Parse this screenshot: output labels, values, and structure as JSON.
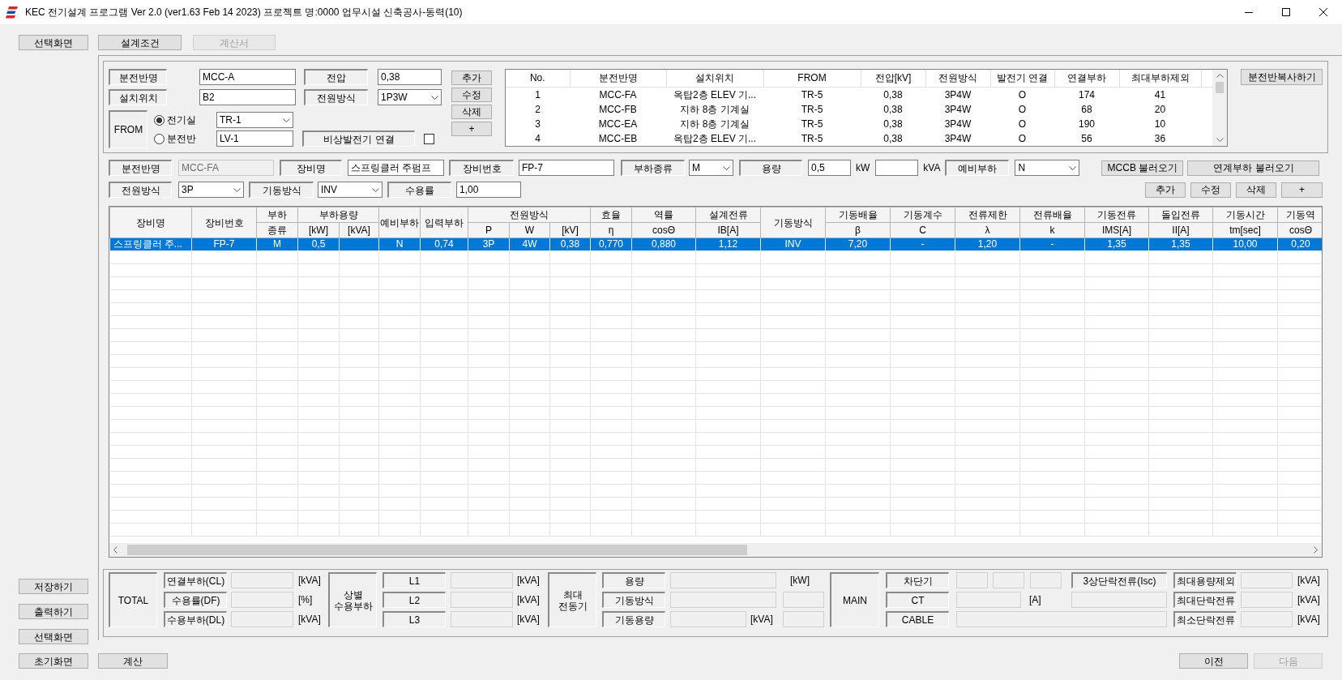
{
  "window": {
    "title": "KEC 전기설계 프로그램 Ver 2.0 (ver1.63 Feb 14 2023) 프로젝트 명:0000 업무시설 신축공사-동력(10)"
  },
  "top_buttons": [
    {
      "label": "선택화면",
      "disabled": false
    },
    {
      "label": "설계조건",
      "disabled": false
    },
    {
      "label": "계산서",
      "disabled": true
    }
  ],
  "panel_form": {
    "name": {
      "label": "분전반명",
      "value": "MCC-A"
    },
    "voltage": {
      "label": "전압",
      "value": "0,38"
    },
    "location": {
      "label": "설치위치",
      "value": "B2"
    },
    "power_system": {
      "label": "전원방식",
      "value": "1P3W"
    },
    "from": {
      "label": "FROM",
      "options": [
        {
          "label": "전기실",
          "selected": true,
          "kind": "dropdown",
          "value": "TR-1"
        },
        {
          "label": "분전반",
          "selected": false,
          "kind": "text",
          "value": "LV-1"
        }
      ]
    },
    "generator": {
      "label": "비상발전기 연결",
      "checked": false
    },
    "buttons": [
      "추가",
      "수정",
      "삭제",
      "+"
    ]
  },
  "panel_list": {
    "columns": [
      "No.",
      "분전반명",
      "설치위치",
      "FROM",
      "전압[kV]",
      "전원방식",
      "발전기 연결",
      "연결부하",
      "최대부하제외"
    ],
    "rows": [
      [
        "1",
        "MCC-FA",
        "옥탑2층 ELEV 기...",
        "TR-5",
        "0,38",
        "3P4W",
        "O",
        "174",
        "41"
      ],
      [
        "2",
        "MCC-FB",
        "지하 8층 기계실",
        "TR-5",
        "0,38",
        "3P4W",
        "O",
        "68",
        "20"
      ],
      [
        "3",
        "MCC-EA",
        "지하 8층 기계실",
        "TR-5",
        "0,38",
        "3P4W",
        "O",
        "190",
        "10"
      ],
      [
        "4",
        "MCC-EB",
        "옥탑2층 ELEV 기...",
        "TR-5",
        "0,38",
        "3P4W",
        "O",
        "56",
        "36"
      ]
    ]
  },
  "copy_button": "분전반복사하기",
  "load_form": {
    "row_1": [
      {
        "kind": "label",
        "text": "분전반명"
      },
      {
        "kind": "readonly",
        "text": "MCC-FA"
      },
      {
        "kind": "label",
        "text": "장비명"
      },
      {
        "kind": "field",
        "text": "스프링클러 주펌프"
      },
      {
        "kind": "label",
        "text": "장비번호"
      },
      {
        "kind": "field",
        "text": "FP-7"
      },
      {
        "kind": "label",
        "text": "부하종류"
      },
      {
        "kind": "dropdown",
        "text": "M"
      },
      {
        "kind": "label",
        "text": "용량"
      },
      {
        "kind": "field",
        "text": "0,5"
      },
      {
        "kind": "unit",
        "text": "kW"
      },
      {
        "kind": "field"
      },
      {
        "kind": "unit",
        "text": "kVA"
      },
      {
        "kind": "label",
        "text": "예비부하"
      },
      {
        "kind": "dropdown",
        "text": "N"
      },
      {
        "kind": "button",
        "text": "MCCB 불러오기"
      },
      {
        "kind": "button",
        "text": "연계부하 불러오기"
      }
    ],
    "row_2": [
      {
        "kind": "label",
        "text": "전원방식"
      },
      {
        "kind": "dropdown",
        "text": "3P"
      },
      {
        "kind": "label",
        "text": "기동방식"
      },
      {
        "kind": "dropdown",
        "text": "INV"
      },
      {
        "kind": "label",
        "text": "수용률"
      },
      {
        "kind": "field",
        "text": "1,00"
      },
      {
        "kind": "button",
        "text": "추가"
      },
      {
        "kind": "button",
        "text": "수정"
      },
      {
        "kind": "button",
        "text": "삭제"
      },
      {
        "kind": "button",
        "text": "+"
      }
    ]
  },
  "load_grid": {
    "column_groups": [
      {
        "label": "부하용량"
      },
      {
        "label": "전원방식"
      }
    ],
    "columns": [
      {
        "label": "장비명"
      },
      {
        "label": "장비번호"
      },
      {
        "label": "부하",
        "sub": "종류"
      },
      {
        "label": "[kW]",
        "grouped": true
      },
      {
        "label": "[kVA]",
        "grouped": true
      },
      {
        "label": "예비부하"
      },
      {
        "label": "입력부하"
      },
      {
        "label": "P",
        "grouped": true
      },
      {
        "label": "W",
        "grouped": true
      },
      {
        "label": "[kV]",
        "grouped": true
      },
      {
        "label": "효율",
        "sub": "η"
      },
      {
        "label": "역률",
        "sub": "cosΘ"
      },
      {
        "label": "설계전류",
        "sub": "IB[A]"
      },
      {
        "label": "기동방식"
      },
      {
        "label": "기동배율",
        "sub": "β"
      },
      {
        "label": "기동계수",
        "sub": "C"
      },
      {
        "label": "전류제한",
        "sub": "λ"
      },
      {
        "label": "전류배율",
        "sub": "k"
      },
      {
        "label": "기동전류",
        "sub": "IMS[A]"
      },
      {
        "label": "돌입전류",
        "sub": "II[A]"
      },
      {
        "label": "기동시간",
        "sub": "tm[sec]"
      },
      {
        "label": "기동역",
        "sub": "cosΘ"
      }
    ],
    "rows": [
      {
        "selected": true,
        "cells": [
          "스프링클러 주...",
          "FP-7",
          "M",
          "0,5",
          null,
          "N",
          "0,74",
          "3P",
          "4W",
          "0,38",
          "0,770",
          "0,880",
          "1,12",
          "INV",
          "7,20",
          "-",
          "1,20",
          "-",
          "1,35",
          "1,35",
          "10,00",
          "0,20"
        ]
      }
    ]
  },
  "summary": {
    "total": {
      "label": "TOTAL",
      "rows": [
        {
          "label": "연결부하(CL)",
          "unit": "[kVA]"
        },
        {
          "label": "수용률(DF)",
          "unit": "[%]"
        },
        {
          "label": "수용부하(DL)",
          "unit": "[kVA]"
        }
      ]
    },
    "phase_load": {
      "label": "상별 수용부하",
      "rows": [
        {
          "label": "L1",
          "unit": "[kVA]"
        },
        {
          "label": "L2",
          "unit": "[kVA]"
        },
        {
          "label": "L3",
          "unit": "[kVA]"
        }
      ]
    },
    "max_motor": {
      "label": "최대 전동기",
      "rows": [
        {
          "label": "용량",
          "unit": "[kW]"
        },
        {
          "label": "기동방식"
        },
        {
          "label": "기동용량",
          "unit": "[kVA]"
        }
      ]
    },
    "main": {
      "label": "MAIN",
      "rows": [
        {
          "label": "차단기"
        },
        {
          "label": "CT",
          "unit": "[A]"
        },
        {
          "label": "CABLE"
        }
      ],
      "isc_label": "3상단락전류(Isc)"
    },
    "limits": [
      {
        "label": "최대용량제외",
        "unit": "[kVA]"
      },
      {
        "label": "최대단락전류",
        "unit": "[kVA]"
      },
      {
        "label": "최소단락전류",
        "unit": "[kVA]"
      }
    ]
  },
  "side_buttons": [
    "저장하기",
    "출력하기",
    "선택화면"
  ],
  "footer_buttons": [
    {
      "label": "초기화면",
      "disabled": false
    },
    {
      "label": "계산",
      "disabled": false
    },
    {
      "label": "이전",
      "disabled": false
    },
    {
      "label": "다음",
      "disabled": true
    }
  ]
}
